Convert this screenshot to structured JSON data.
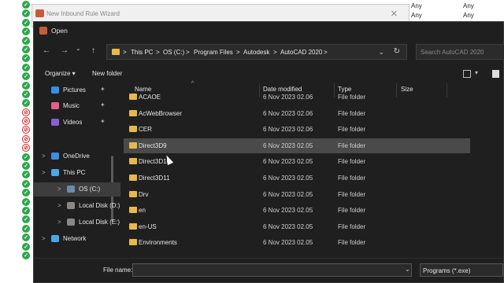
{
  "background": {
    "rows": [
      {
        "col1": "Any",
        "col2": "Any"
      },
      {
        "col1": "Any",
        "col2": "Any"
      }
    ],
    "icon_states": [
      "ok",
      "ok",
      "ok",
      "ok",
      "ok",
      "ok",
      "ok",
      "ok",
      "ok",
      "ok",
      "ok",
      "ok",
      "no",
      "no",
      "no",
      "no",
      "no",
      "ok",
      "ok",
      "ok",
      "ok",
      "ok",
      "ok",
      "ok",
      "ok",
      "ok",
      "ok",
      "ok",
      "ok"
    ]
  },
  "wizard": {
    "title": "New Inbound Rule Wizard",
    "close": "✕"
  },
  "dialog": {
    "title": "Open",
    "nav": {
      "back": "←",
      "forward": "→",
      "dropdown": "⌄",
      "up": "↑"
    },
    "breadcrumb": [
      "This PC",
      "OS (C:)",
      "Program Files",
      "Autodesk",
      "AutoCAD 2020"
    ],
    "separator": ">",
    "address_dropdown": "⌄",
    "refresh": "↻",
    "search_placeholder": "Search AutoCAD 2020",
    "toolbar": {
      "organize": "Organize ▾",
      "new_folder": "New folder",
      "view_dd": "▾"
    },
    "nav_pane": [
      {
        "label": "Pictures",
        "icon": "pictures-icon",
        "color": "#3a8ee6",
        "pinned": true
      },
      {
        "label": "Music",
        "icon": "music-icon",
        "color": "#e0608a",
        "pinned": true
      },
      {
        "label": "Videos",
        "icon": "videos-icon",
        "color": "#8a5fd1",
        "pinned": true
      },
      {
        "label": "OneDrive",
        "icon": "onedrive-icon",
        "color": "#3a8ee6",
        "pinned": false
      },
      {
        "label": "This PC",
        "icon": "this-pc-icon",
        "color": "#4aa8e8",
        "pinned": false
      },
      {
        "label": "OS (C:)",
        "icon": "drive-icon",
        "color": "#6a8bb0",
        "pinned": false
      },
      {
        "label": "Local Disk (D:)",
        "icon": "drive-icon",
        "color": "#888",
        "pinned": false
      },
      {
        "label": "Local Disk (E:)",
        "icon": "drive-icon",
        "color": "#888",
        "pinned": false
      },
      {
        "label": "Network",
        "icon": "network-icon",
        "color": "#4aa8e8",
        "pinned": false
      }
    ],
    "pin_glyph": "📌",
    "chevron": ">",
    "columns": {
      "name": "Name",
      "date": "Date modified",
      "type": "Type",
      "size": "Size"
    },
    "sort_arrow": "^",
    "files": [
      {
        "name": "ACAOE",
        "date": "6 Nov 2023 02.06",
        "type": "File folder"
      },
      {
        "name": "AcWebBrowser",
        "date": "6 Nov 2023 02.06",
        "type": "File folder"
      },
      {
        "name": "CER",
        "date": "6 Nov 2023 02.06",
        "type": "File folder"
      },
      {
        "name": "Direct3D9",
        "date": "6 Nov 2023 02.05",
        "type": "File folder"
      },
      {
        "name": "Direct3D10",
        "date": "6 Nov 2023 02.05",
        "type": "File folder"
      },
      {
        "name": "Direct3D11",
        "date": "6 Nov 2023 02.05",
        "type": "File folder"
      },
      {
        "name": "Drv",
        "date": "6 Nov 2023 02.05",
        "type": "File folder"
      },
      {
        "name": "en",
        "date": "6 Nov 2023 02.05",
        "type": "File folder"
      },
      {
        "name": "en-US",
        "date": "6 Nov 2023 02.05",
        "type": "File folder"
      },
      {
        "name": "Environments",
        "date": "6 Nov 2023 02.05",
        "type": "File folder"
      }
    ],
    "hovered_file": "Direct3D9",
    "file_name_label": "File name:",
    "file_name_value": "",
    "file_name_dropdown": "⌄",
    "file_type": "Programs (*.exe)"
  }
}
